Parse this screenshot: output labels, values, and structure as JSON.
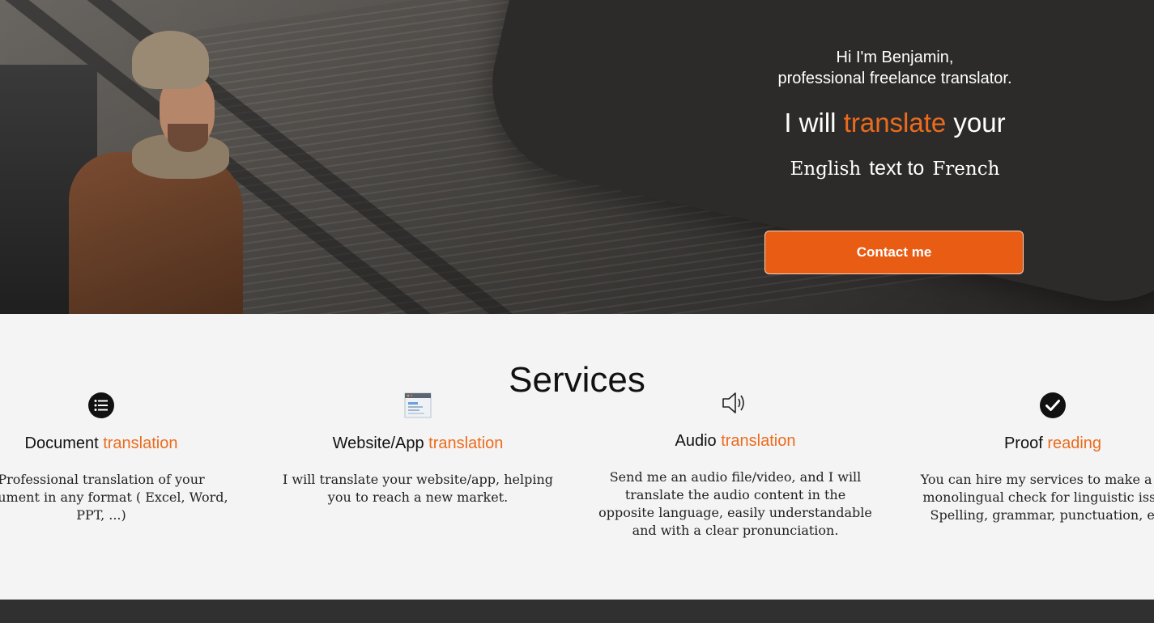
{
  "hero": {
    "greeting_line1": "Hi I'm Benjamin,",
    "greeting_line2": "professional freelance translator.",
    "headline_pre": "I will ",
    "headline_accent": "translate",
    "headline_post": " your",
    "source_language": "English",
    "middle_text": "text to",
    "target_language": "French",
    "contact_label": "Contact me"
  },
  "services": {
    "title": "Services",
    "items": [
      {
        "icon": "list-icon",
        "title_main": "Document",
        "title_accent": "translation",
        "description": "Professional translation of your document in any format ( Excel, Word, PPT, ...)"
      },
      {
        "icon": "browser-window-icon",
        "title_main": "Website/App",
        "title_accent": "translation",
        "description": "I will translate your website/app, helping you to reach a new market."
      },
      {
        "icon": "speaker-icon",
        "title_main": "Audio",
        "title_accent": "translation",
        "description": "Send me an audio file/video, and I will translate the audio content in the opposite language, easily understandable and with a clear pronunciation."
      },
      {
        "icon": "checkmark-circle-icon",
        "title_main": "Proof",
        "title_accent": "reading",
        "description": "You can hire my services to make a final monolingual check for linguistic issues: Spelling, grammar, punctuation, etc.."
      }
    ]
  },
  "colors": {
    "accent": "#ec6b1d",
    "button": "#e95c14",
    "footer": "#303030"
  }
}
